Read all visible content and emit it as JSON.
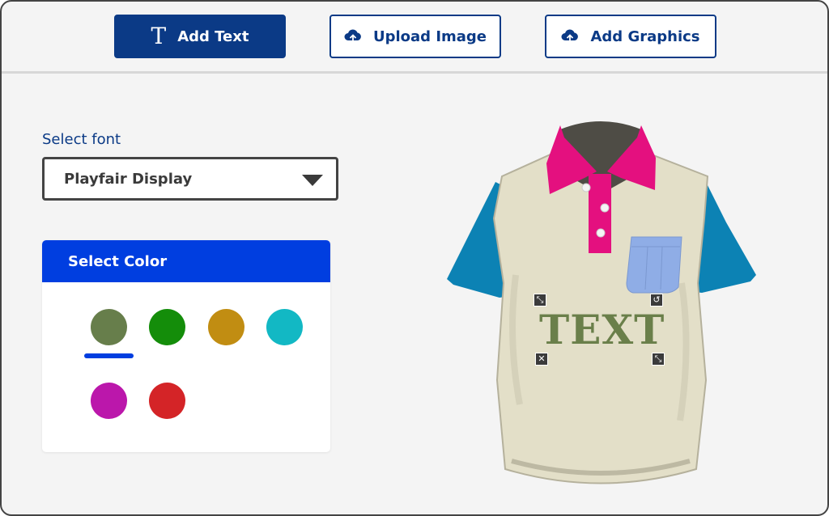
{
  "toolbar": {
    "add_text": {
      "label": "Add Text",
      "icon": "text-T-icon"
    },
    "upload_image": {
      "label": "Upload Image",
      "icon": "cloud-upload-icon"
    },
    "add_graphics": {
      "label": "Add Graphics",
      "icon": "cloud-upload-icon"
    }
  },
  "font": {
    "label": "Select font",
    "selected": "Playfair Display"
  },
  "color": {
    "header": "Select Color",
    "selected_index": 0,
    "swatches": [
      {
        "name": "olive",
        "hex": "#677e4b"
      },
      {
        "name": "green",
        "hex": "#148d0a"
      },
      {
        "name": "gold",
        "hex": "#c18d12"
      },
      {
        "name": "teal",
        "hex": "#12b8c4"
      },
      {
        "name": "magenta",
        "hex": "#bb17ab"
      },
      {
        "name": "red",
        "hex": "#d42427"
      }
    ]
  },
  "canvas": {
    "design_text": "TEXT",
    "design_text_color": "#6a7f4a",
    "shirt": {
      "body_color": "#e3dfc8",
      "collar_color": "#e4107f",
      "sleeve_color": "#0c82b4",
      "pocket_color": "#8fade6"
    },
    "handles": {
      "top_left": "resize-icon",
      "top_right": "rotate-icon",
      "bottom_left": "delete-icon",
      "bottom_right": "scale-icon"
    }
  },
  "colors": {
    "primary": "#0b3a86",
    "accent": "#003ee0"
  }
}
